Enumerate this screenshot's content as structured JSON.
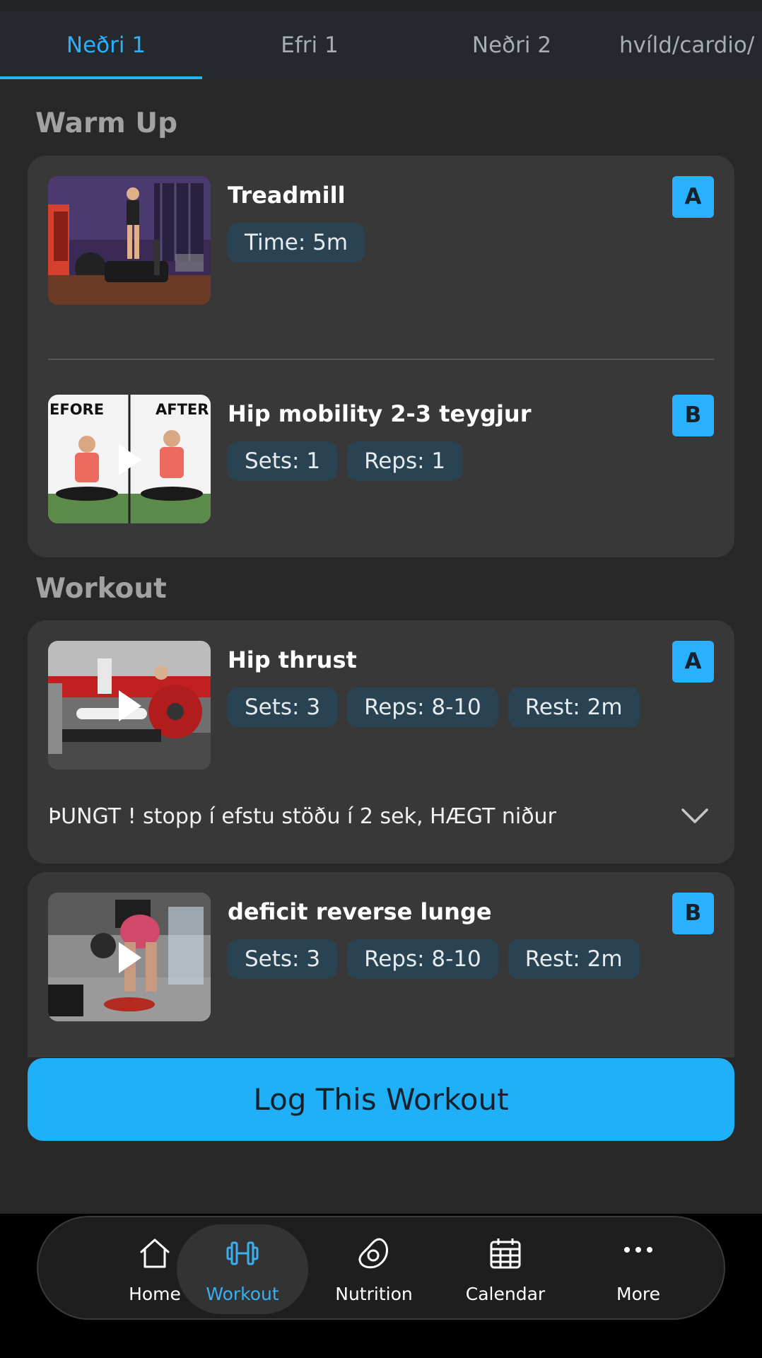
{
  "tabs": [
    {
      "label": "Neðri 1",
      "active": true
    },
    {
      "label": "Efri 1",
      "active": false
    },
    {
      "label": "Neðri 2",
      "active": false
    },
    {
      "label": "hvíld/cardio/",
      "active": false
    }
  ],
  "sections": {
    "warmup": {
      "title": "Warm Up",
      "exercises": [
        {
          "name": "Treadmill",
          "letter": "A",
          "badges": [
            "Time: 5m"
          ]
        },
        {
          "name": "Hip mobility 2-3 teygjur",
          "letter": "B",
          "badges": [
            "Sets: 1",
            "Reps: 1"
          ],
          "thumb_text_left": "EFORE",
          "thumb_text_right": "AFTER"
        }
      ]
    },
    "workout": {
      "title": "Workout",
      "exercises": [
        {
          "name": "Hip thrust",
          "letter": "A",
          "badges": [
            "Sets: 3",
            "Reps: 8-10",
            "Rest: 2m"
          ],
          "note": "ÞUNGT ! stopp í efstu stöðu í 2 sek, HÆGT niður"
        },
        {
          "name": "deficit reverse lunge",
          "letter": "B",
          "badges": [
            "Sets: 3",
            "Reps: 8-10",
            "Rest: 2m"
          ]
        }
      ]
    }
  },
  "log_button": {
    "label": "Log This Workout"
  },
  "nav": [
    {
      "label": "Home",
      "icon": "home-icon",
      "active": false
    },
    {
      "label": "Workout",
      "icon": "dumbbell-icon",
      "active": true
    },
    {
      "label": "Nutrition",
      "icon": "avocado-icon",
      "active": false
    },
    {
      "label": "Calendar",
      "icon": "calendar-icon",
      "active": false
    },
    {
      "label": "More",
      "icon": "more-icon",
      "active": false
    }
  ],
  "colors": {
    "accent": "#29b1ff",
    "card": "#383838",
    "badge": "#2a4353",
    "background": "#282828"
  }
}
